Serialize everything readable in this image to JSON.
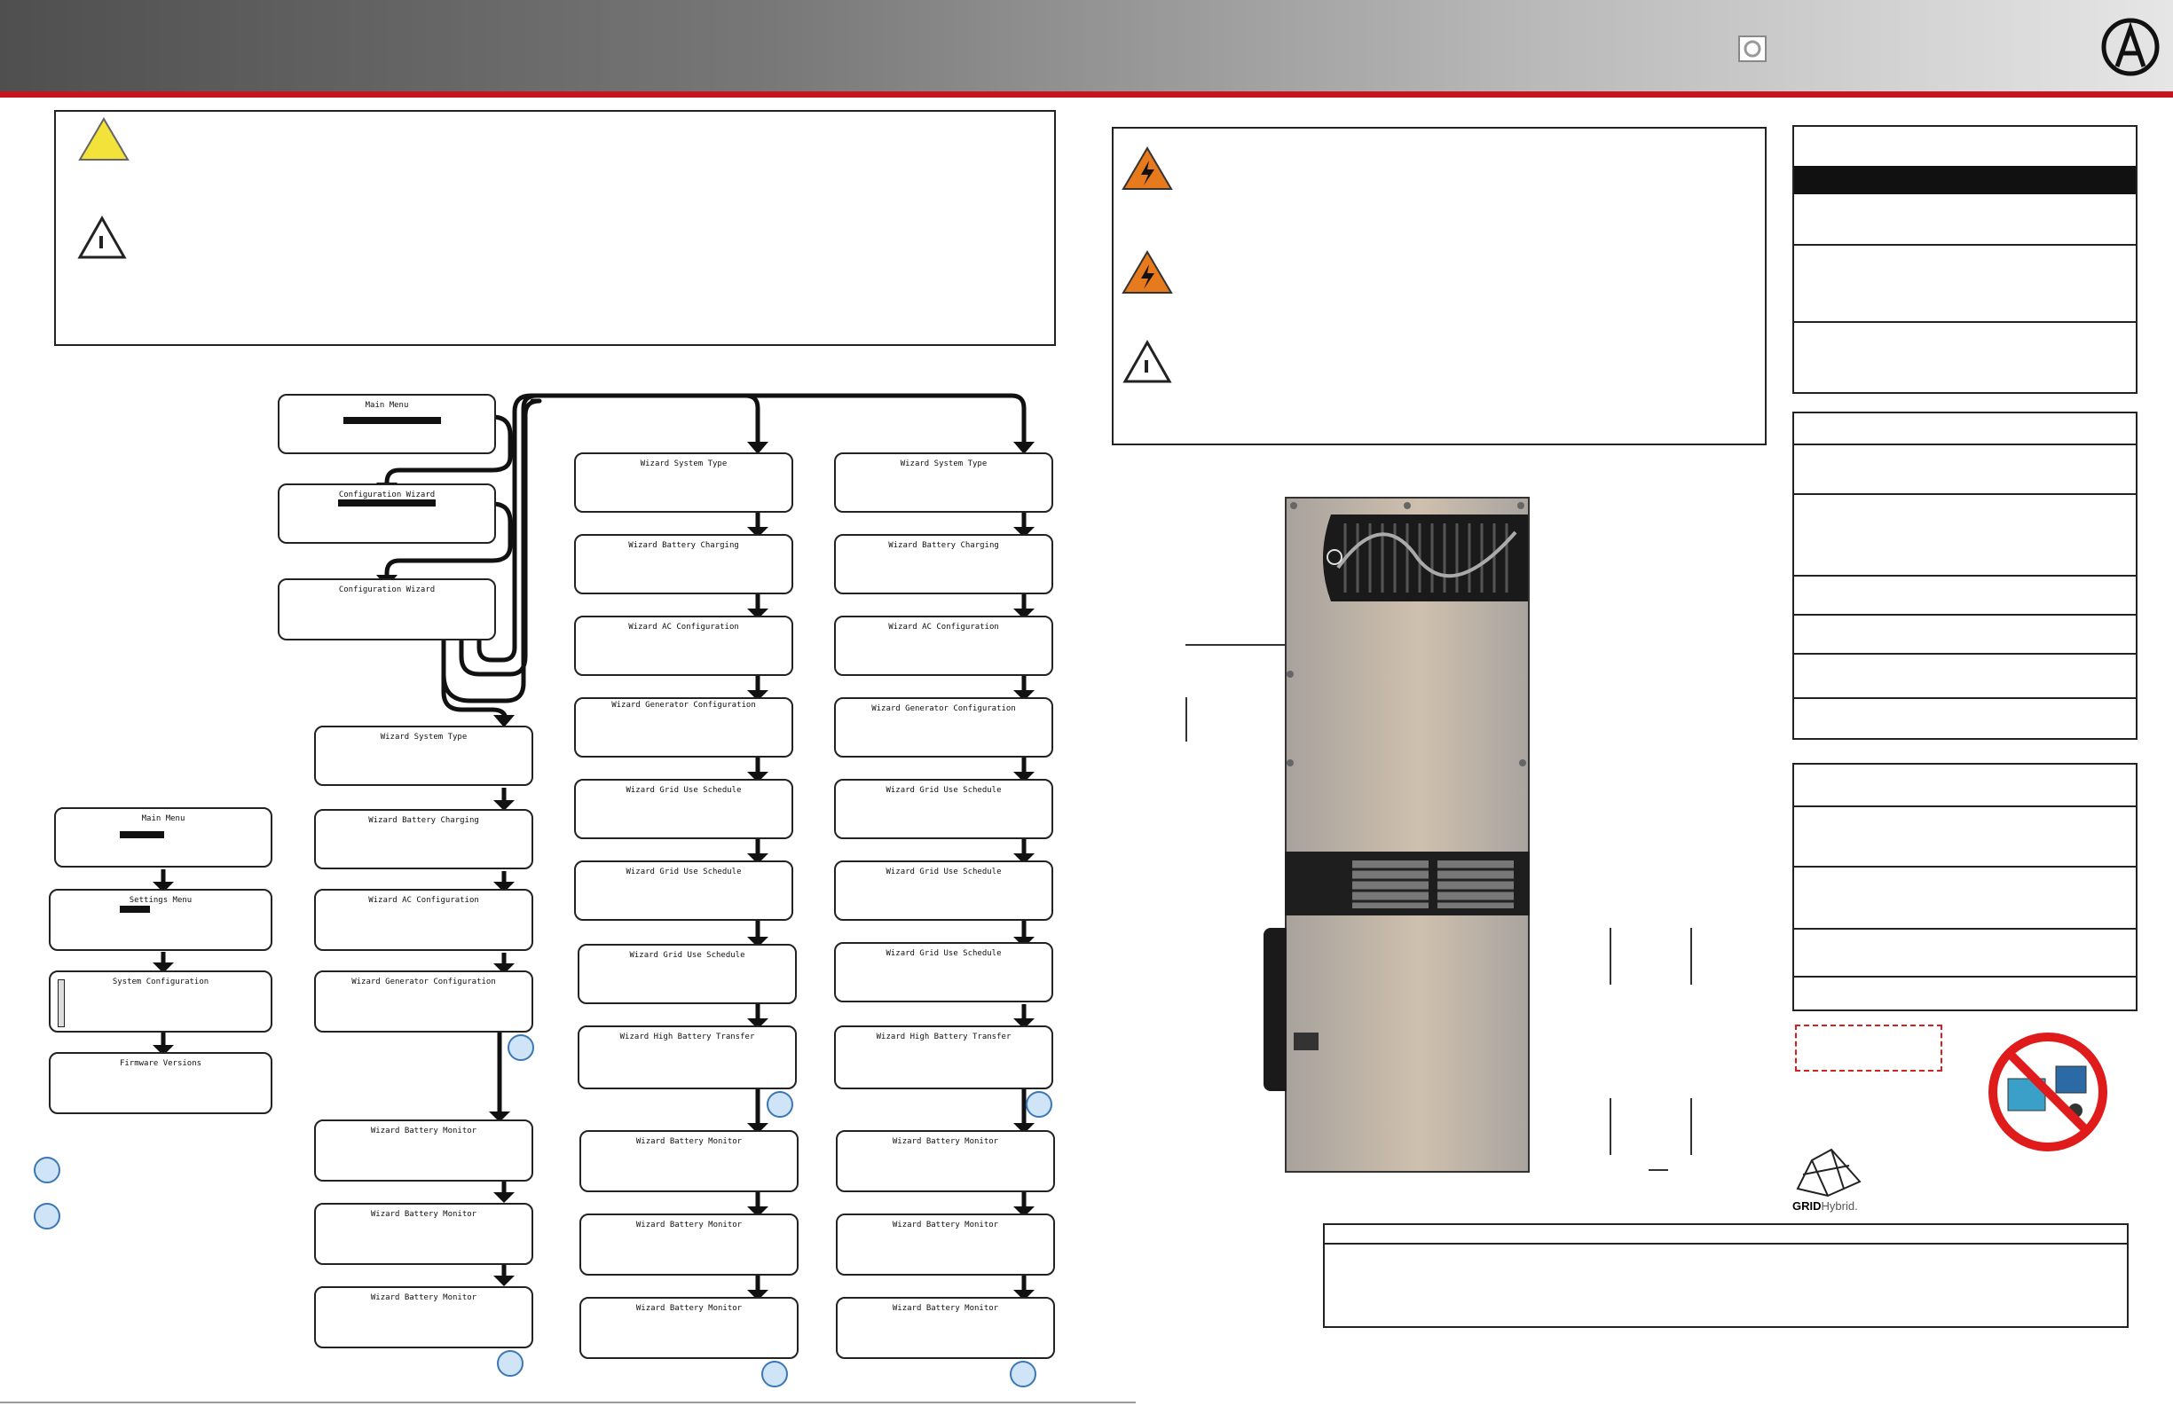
{
  "flowchart": {
    "main_menu": "Main Menu",
    "configuration_wizard": "Configuration Wizard",
    "wizard_system_type": "Wizard System Type",
    "wizard_battery_charging": "Wizard Battery Charging",
    "wizard_ac_configuration": "Wizard AC Configuration",
    "wizard_generator_configuration": "Wizard Generator Configuration",
    "wizard_grid_use_schedule": "Wizard Grid Use Schedule",
    "wizard_high_battery_transfer": "Wizard High Battery Transfer",
    "wizard_battery_monitor": "Wizard Battery Monitor",
    "settings_menu": "Settings Menu",
    "system_configuration": "System Configuration",
    "firmware_versions": "Firmware Versions"
  },
  "logo": {
    "grid_hybrid_bold": "GRID",
    "grid_hybrid_light": "Hybrid."
  },
  "icons": [
    "caution-icon",
    "note-icon",
    "shock-hazard-icon",
    "no-equipment-icon",
    "company-logo-icon",
    "brand-mark-icon"
  ],
  "colors": {
    "header_accent": "#c8141e",
    "warning_orange": "#e87a1e",
    "caution_yellow": "#f2e23a",
    "marker_blue": "#cfe4f7"
  }
}
